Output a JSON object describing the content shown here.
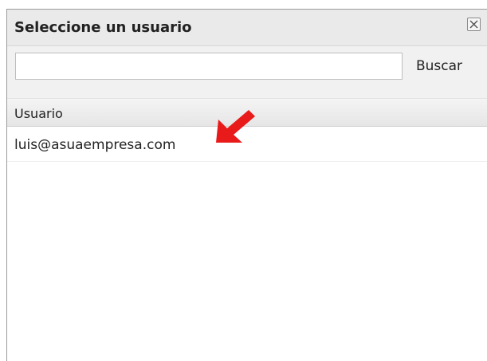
{
  "dialog": {
    "title": "Seleccione un usuario",
    "close_icon": "close-icon"
  },
  "search": {
    "value": "",
    "placeholder": "",
    "button_label": "Buscar"
  },
  "table": {
    "columns": [
      "Usuario"
    ],
    "rows": [
      {
        "usuario": "luis@asuaempresa.com"
      }
    ]
  },
  "annotation": {
    "arrow_icon": "red-arrow-icon",
    "arrow_color": "#e81a1a"
  },
  "colors": {
    "titlebar_bg": "#eaeaea",
    "header_bg": "#ececec",
    "border": "#9a9a9a"
  }
}
